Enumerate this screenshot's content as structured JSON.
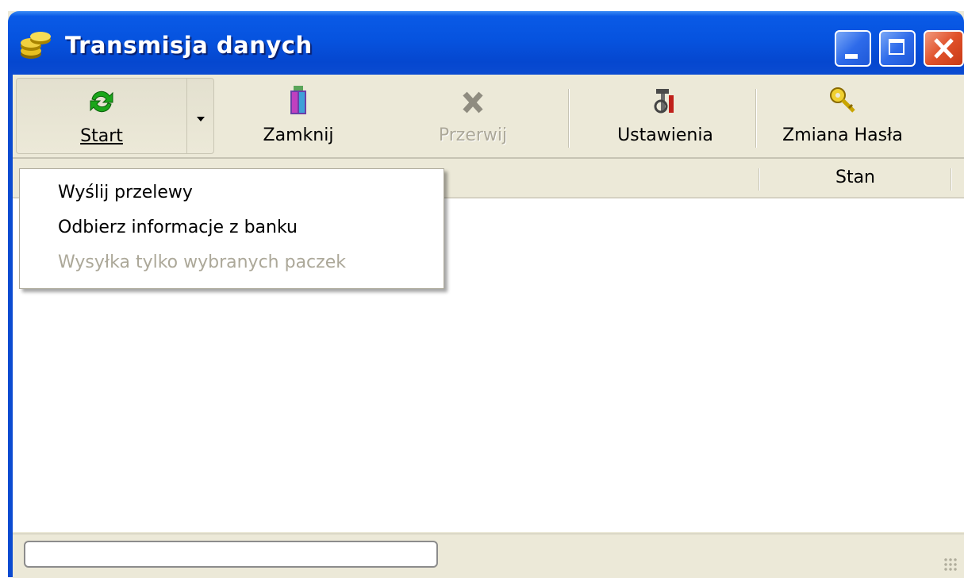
{
  "window": {
    "title": "Transmisja danych",
    "icon": "coins-icon",
    "controls": {
      "minimize": "minimize-button",
      "maximize": "maximize-button",
      "close": "close-button"
    }
  },
  "toolbar": {
    "start_label": "Start",
    "start_icon": "refresh-icon",
    "close_label": "Zamknij",
    "close_icon": "door-exit-icon",
    "abort_label": "Przerwij",
    "abort_icon": "x-mark-icon",
    "settings_label": "Ustawienia",
    "settings_icon": "tools-icon",
    "password_label": "Zmiana Hasła",
    "password_icon": "key-icon"
  },
  "list": {
    "columns": [
      "",
      "Stan",
      ""
    ]
  },
  "dropdown": {
    "items": [
      {
        "label": "Wyślij przelewy",
        "enabled": true
      },
      {
        "label": "Odbierz informacje z banku",
        "enabled": true
      },
      {
        "label": "Wysyłka tylko wybranych paczek",
        "enabled": false
      }
    ]
  },
  "colors": {
    "titlebar": "#0653df",
    "face": "#ece9d8",
    "disabled_text": "#aca899"
  }
}
